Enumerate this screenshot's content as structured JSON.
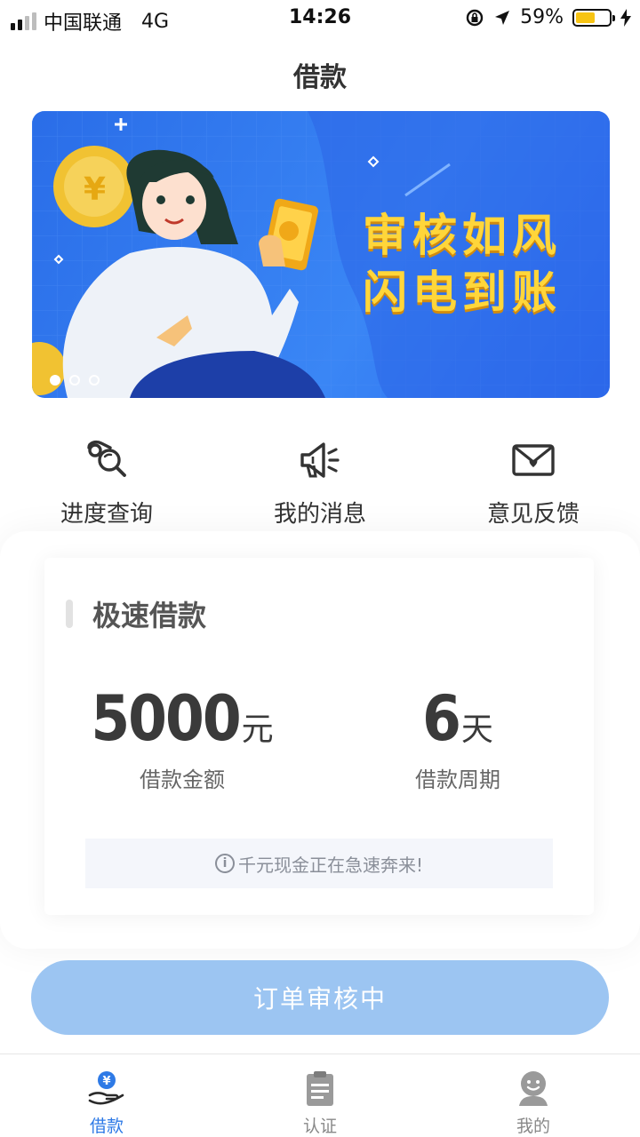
{
  "status_bar": {
    "carrier": "中国联通",
    "network": "4G",
    "time": "14:26",
    "battery": "59%",
    "battery_level": 0.59
  },
  "header": {
    "title": "借款"
  },
  "banner": {
    "headline_line1": "审核如风",
    "headline_line2": "闪电到账",
    "slide_count": 3,
    "active_slide": 1
  },
  "quick_actions": [
    {
      "label": "进度查询",
      "icon": "progress-search-icon"
    },
    {
      "label": "我的消息",
      "icon": "megaphone-icon"
    },
    {
      "label": "意见反馈",
      "icon": "envelope-heart-icon"
    }
  ],
  "loan_card": {
    "title": "极速借款",
    "amount_value": "5000",
    "amount_unit": "元",
    "amount_label": "借款金额",
    "period_value": "6",
    "period_unit": "天",
    "period_label": "借款周期",
    "notice_icon": "i",
    "notice": "千元现金正在急速奔来!"
  },
  "primary_button": {
    "label": "订单审核中"
  },
  "tabbar": [
    {
      "label": "借款",
      "icon": "hand-coin-icon",
      "active": true
    },
    {
      "label": "认证",
      "icon": "clipboard-icon",
      "active": false
    },
    {
      "label": "我的",
      "icon": "user-face-icon",
      "active": false
    }
  ],
  "colors": {
    "accent": "#2e7ae6",
    "button_disabled": "#9cc5f2",
    "banner_blue": "#2a6de8",
    "banner_text": "#ffd63a"
  }
}
